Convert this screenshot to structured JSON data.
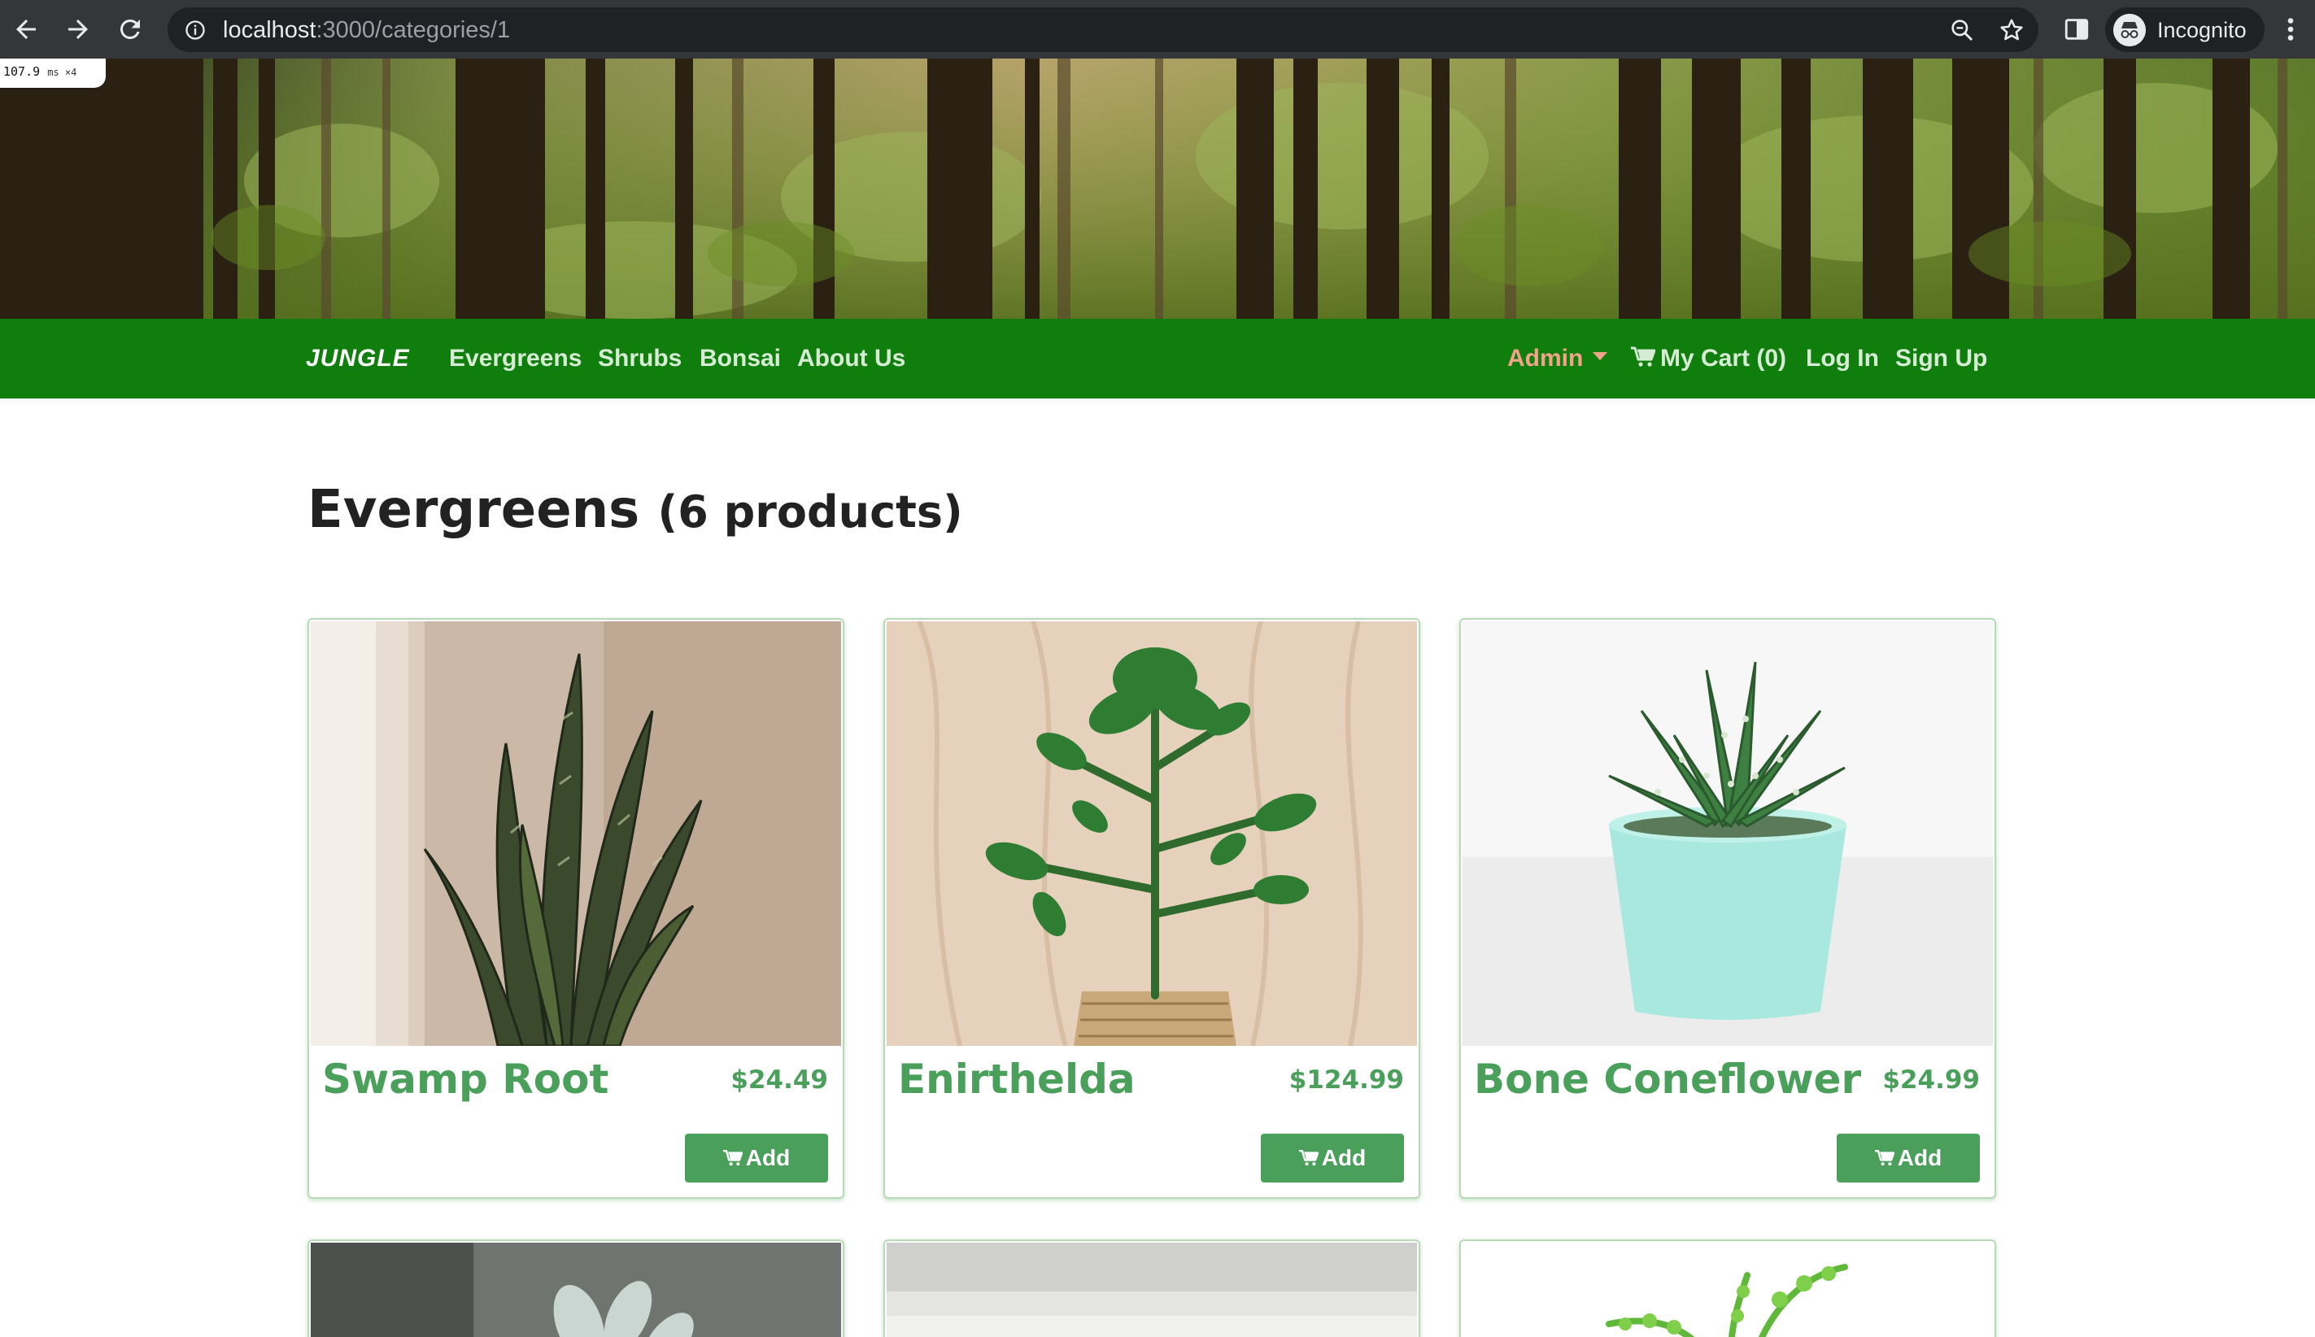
{
  "browser": {
    "url_host": "localhost",
    "url_path": ":3000/categories/1",
    "profile_label": "Incognito",
    "icons": [
      "back-arrow-icon",
      "forward-arrow-icon",
      "reload-icon",
      "info-icon",
      "zoom-icon",
      "star-icon",
      "side-panel-icon",
      "incognito-icon",
      "kebab-menu-icon"
    ]
  },
  "perf_badge": {
    "value": "107.9",
    "unit": "ms ×4"
  },
  "navbar": {
    "brand": "JUNGLE",
    "links": [
      "Evergreens",
      "Shrubs",
      "Bonsai",
      "About Us"
    ],
    "admin": "Admin",
    "cart": "My Cart (0)",
    "login": "Log In",
    "signup": "Sign Up",
    "colors": {
      "bar": "#0f7e0c",
      "link": "#d7ecd4",
      "admin": "#f2a48a"
    }
  },
  "category": {
    "name": "Evergreens",
    "count_text": "(6 products)"
  },
  "products": [
    {
      "name": "Swamp Root",
      "price": "$24.49",
      "button": "Add"
    },
    {
      "name": "Enirthelda",
      "price": "$124.99",
      "button": "Add"
    },
    {
      "name": "Bone Coneflower",
      "price": "$24.99",
      "button": "Add"
    }
  ],
  "theme": {
    "accent": "#4a9f5b"
  }
}
